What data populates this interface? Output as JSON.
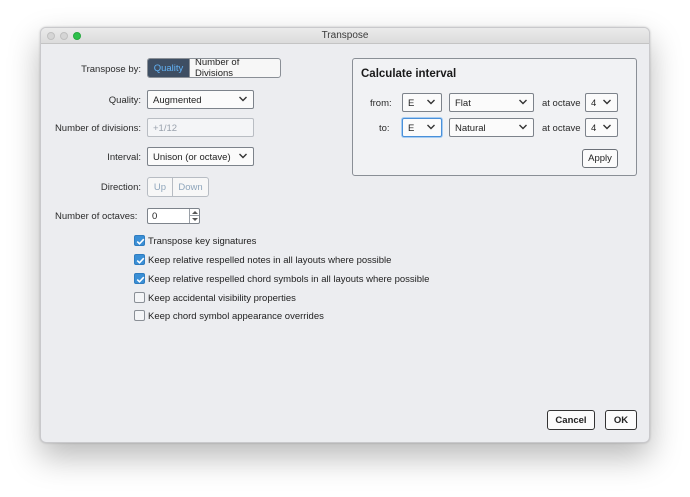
{
  "window": {
    "title": "Transpose"
  },
  "form": {
    "transpose_by_label": "Transpose by:",
    "transpose_by_options": [
      "Quality",
      "Number of Divisions"
    ],
    "quality_label": "Quality:",
    "quality_value": "Augmented",
    "divisions_label": "Number of divisions:",
    "divisions_placeholder": "+1/12",
    "interval_label": "Interval:",
    "interval_value": "Unison (or octave)",
    "direction_label": "Direction:",
    "direction_options": [
      "Up",
      "Down"
    ],
    "octaves_label": "Number of octaves:",
    "octaves_value": "0"
  },
  "options": [
    {
      "label": "Transpose key signatures",
      "checked": true
    },
    {
      "label": "Keep relative respelled notes in all layouts where possible",
      "checked": true
    },
    {
      "label": "Keep relative respelled chord symbols in all layouts where possible",
      "checked": true
    },
    {
      "label": "Keep accidental visibility properties",
      "checked": false
    },
    {
      "label": "Keep chord symbol appearance overrides",
      "checked": false
    }
  ],
  "calc": {
    "title": "Calculate interval",
    "from_label": "from:",
    "from_note": "E",
    "from_accidental": "Flat",
    "from_octave_label": "at octave",
    "from_octave": "4",
    "to_label": "to:",
    "to_note": "E",
    "to_accidental": "Natural",
    "to_octave_label": "at octave",
    "to_octave": "4",
    "apply_label": "Apply"
  },
  "footer": {
    "cancel_label": "Cancel",
    "ok_label": "OK"
  },
  "colors": {
    "accent": "#3a8fd6",
    "selected_segment": "#3e4e63",
    "traffic_green": "#2dc04a"
  }
}
